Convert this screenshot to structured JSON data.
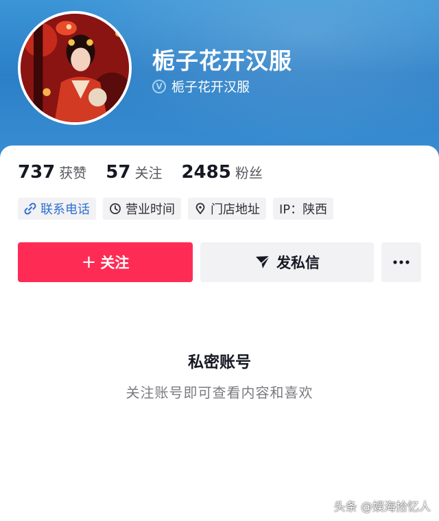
{
  "profile": {
    "nickname": "栀子花开汉服",
    "verified_name": "栀子花开汉服",
    "verified_badge": "V"
  },
  "stats": [
    {
      "value": "737",
      "label": "获赞"
    },
    {
      "value": "57",
      "label": "关注"
    },
    {
      "value": "2485",
      "label": "粉丝"
    }
  ],
  "chips": [
    {
      "icon": "phone-link-icon",
      "label": "联系电话"
    },
    {
      "icon": "clock-icon",
      "label": "营业时间"
    },
    {
      "icon": "location-pin-icon",
      "label": "门店地址"
    },
    {
      "icon": "",
      "label": "IP：陕西"
    }
  ],
  "actions": {
    "follow_label": "关注",
    "follow_icon": "+",
    "message_label": "发私信",
    "more_icon": "more-dots-icon"
  },
  "private": {
    "title": "私密账号",
    "subtitle": "关注账号即可查看内容和喜欢"
  },
  "watermark": "头条 @娱海拾忆人",
  "colors": {
    "header_blue": "#2b7fc7",
    "follow_red": "#fe2c55",
    "link_blue": "#2f6fd0",
    "chip_bg": "#f2f2f4"
  }
}
